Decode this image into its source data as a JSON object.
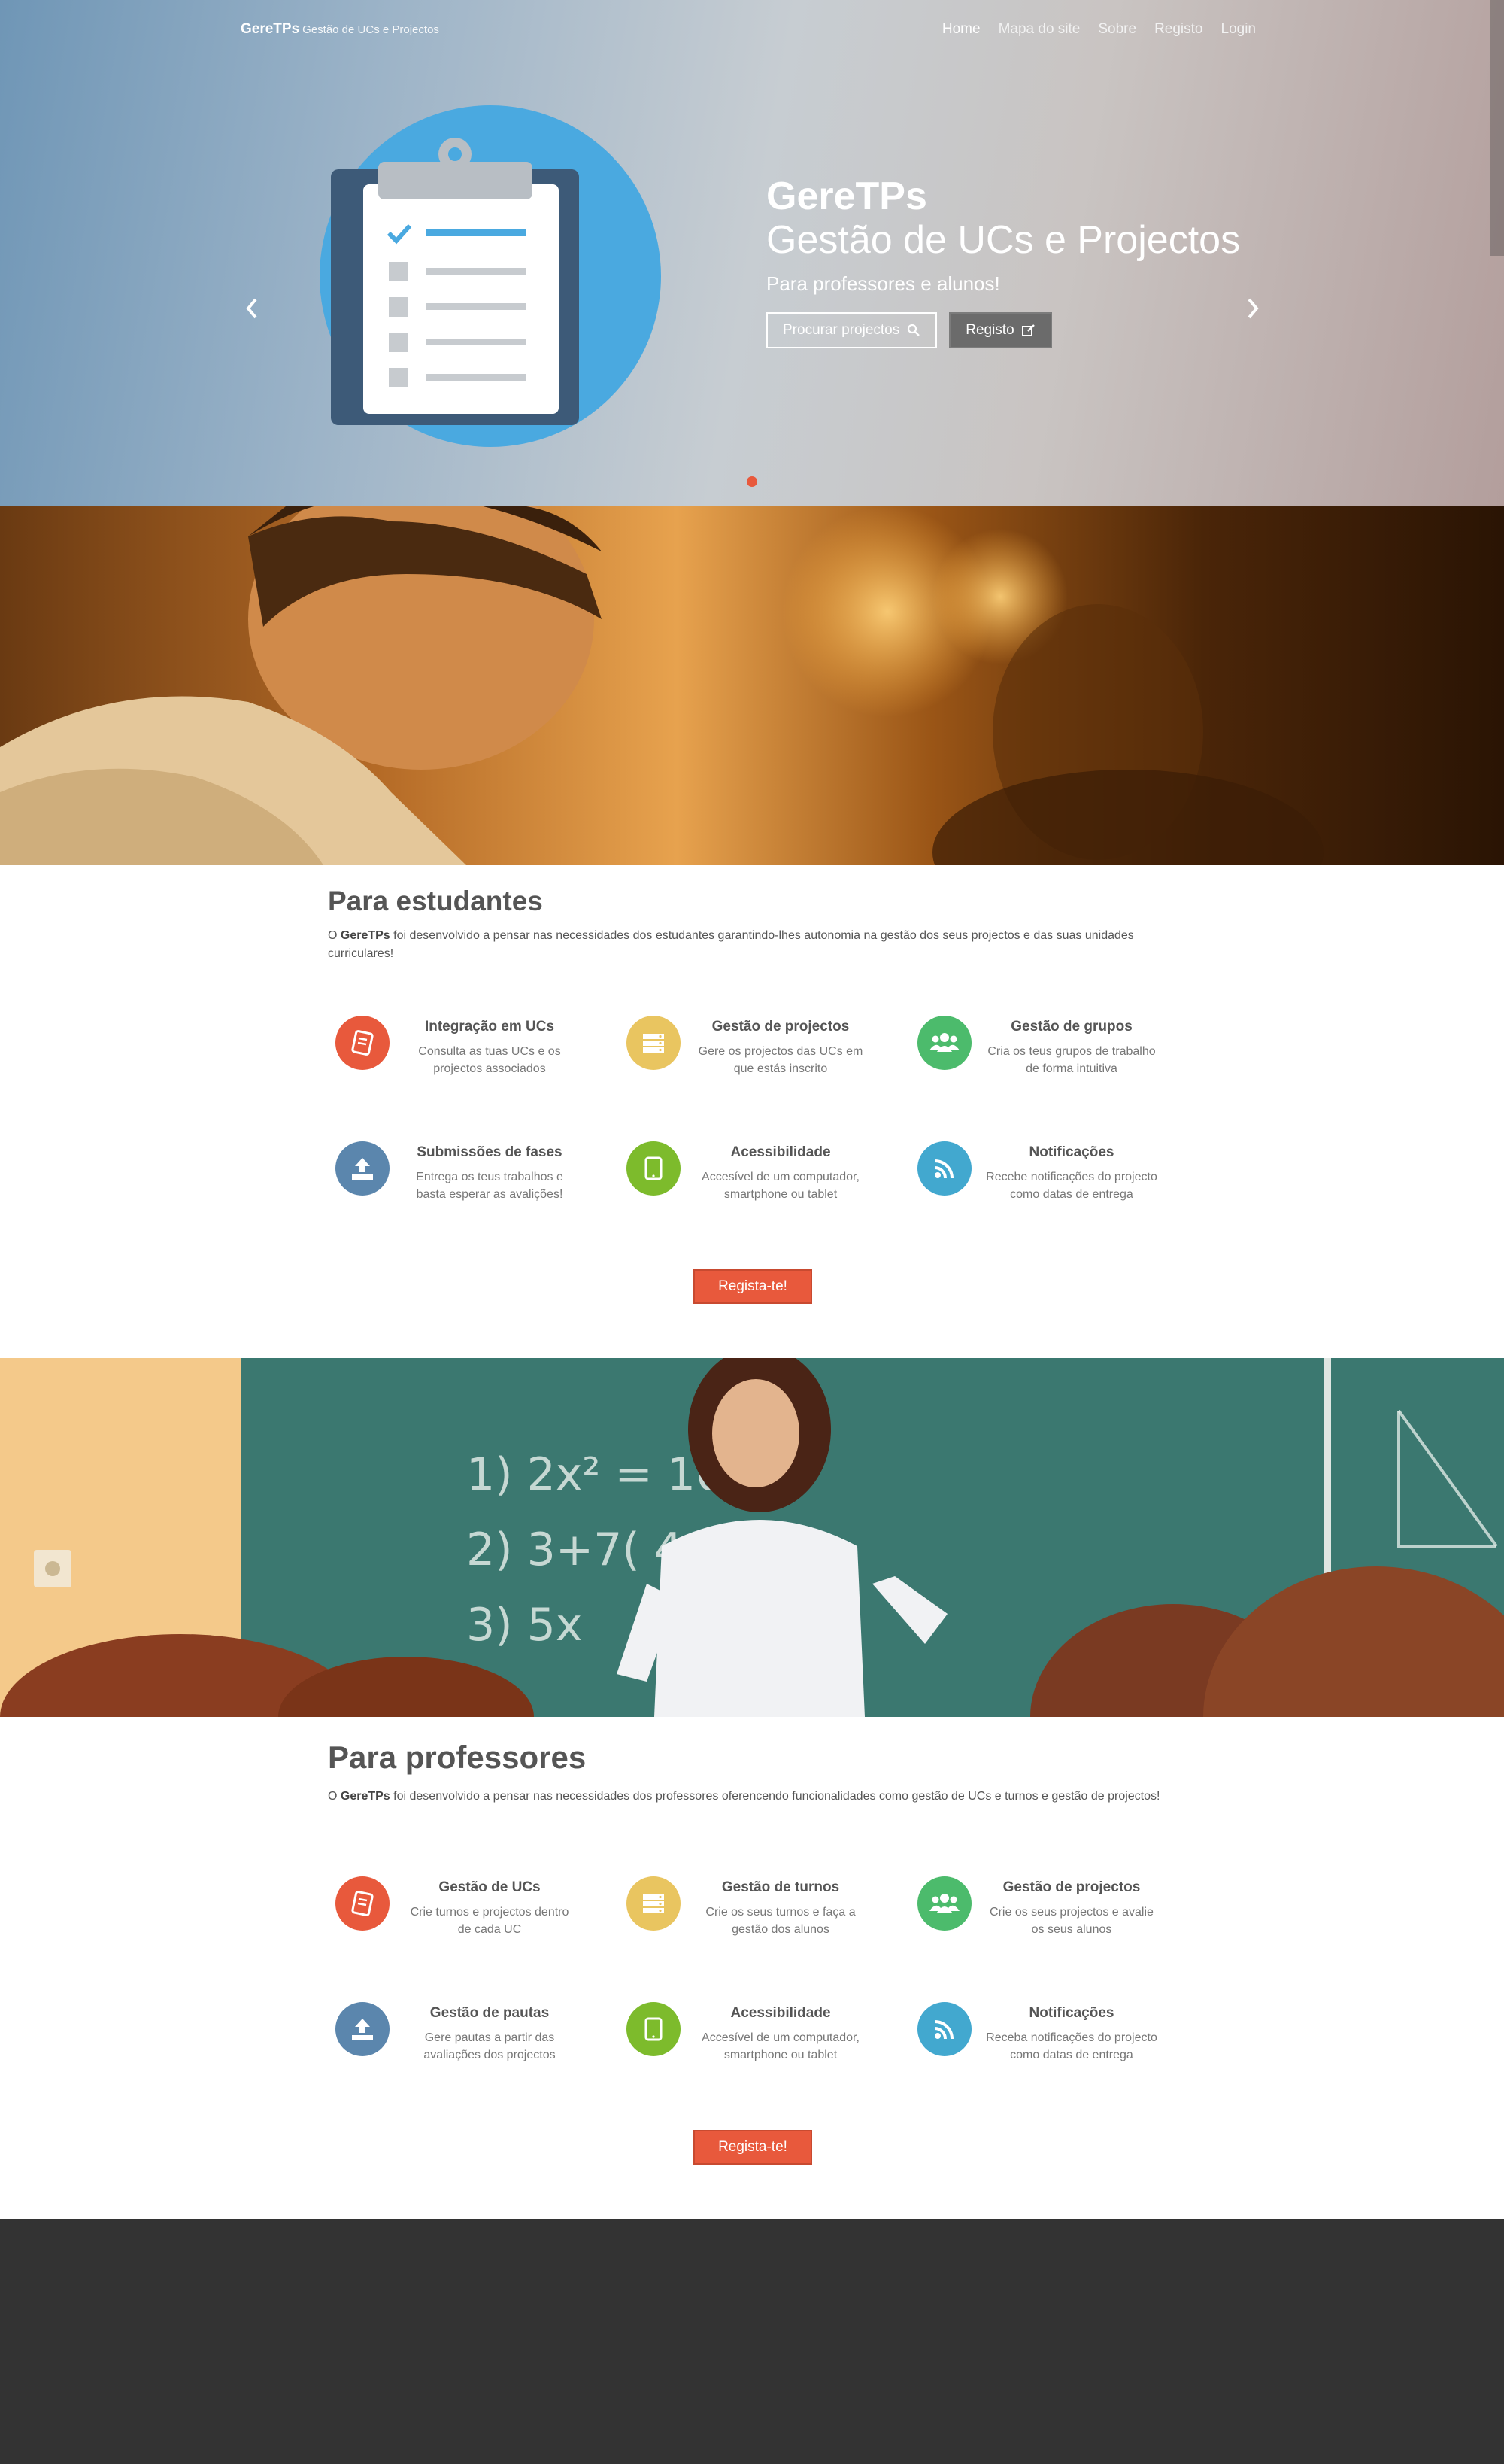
{
  "navbar": {
    "brand_name": "GereTPs",
    "brand_tagline": "Gestão de UCs e Projectos",
    "items": [
      {
        "label": "Home"
      },
      {
        "label": "Mapa do site"
      },
      {
        "label": "Sobre"
      },
      {
        "label": "Registo"
      },
      {
        "label": "Login"
      }
    ]
  },
  "hero": {
    "title": "GereTPs",
    "subtitle": "Gestão de UCs e Projectos",
    "tagline": "Para professores e alunos!",
    "search_button": "Procurar projectos",
    "register_button": "Registo",
    "prev_icon": "chevron-left-icon",
    "next_icon": "chevron-right-icon"
  },
  "students": {
    "title": "Para estudantes",
    "desc_brand": "GereTPs",
    "desc_prefix": "O ",
    "desc_rest": " foi desenvolvido a pensar nas necessidades dos estudantes garantindo-lhes autonomia na gestão dos seus projectos e das suas unidades curriculares!",
    "features": [
      {
        "title": "Integração em UCs",
        "text": "Consulta as tuas UCs e os projectos associados",
        "icon": "book-icon",
        "color": "#e8593c"
      },
      {
        "title": "Gestão de projectos",
        "text": "Gere os projectos das UCs em que estás inscrito",
        "icon": "server-icon",
        "color": "#e9c560"
      },
      {
        "title": "Gestão de grupos",
        "text": "Cria os teus grupos de trabalho de forma intuitiva",
        "icon": "group-icon",
        "color": "#4cbb6c"
      },
      {
        "title": "Submissões de fases",
        "text": "Entrega os teus trabalhos e basta esperar as avalições!",
        "icon": "upload-icon",
        "color": "#5b86ad"
      },
      {
        "title": "Acessibilidade",
        "text": "Accesível de um computador, smartphone ou tablet",
        "icon": "tablet-icon",
        "color": "#7dbb2c"
      },
      {
        "title": "Notificações",
        "text": "Recebe notificações do projecto como datas de entrega",
        "icon": "rss-icon",
        "color": "#42a8cf"
      }
    ],
    "cta": "Regista-te!"
  },
  "teachers": {
    "title": "Para professores",
    "desc_brand": "GereTPs",
    "desc_prefix": "O ",
    "desc_rest": " foi desenvolvido a pensar nas necessidades dos professores oferencendo funcionalidades como gestão de UCs e turnos e gestão de projectos!",
    "features": [
      {
        "title": "Gestão de UCs",
        "text": "Crie turnos e projectos dentro de cada UC",
        "icon": "book-icon",
        "color": "#e8593c"
      },
      {
        "title": "Gestão de turnos",
        "text": "Crie os seus turnos e faça a gestão dos alunos",
        "icon": "server-icon",
        "color": "#e9c560"
      },
      {
        "title": "Gestão de projectos",
        "text": "Crie os seus projectos e avalie os seus alunos",
        "icon": "group-icon",
        "color": "#4cbb6c"
      },
      {
        "title": "Gestão de pautas",
        "text": "Gere pautas a partir das avaliações dos projectos",
        "icon": "upload-icon",
        "color": "#5b86ad"
      },
      {
        "title": "Acessibilidade",
        "text": "Accesível de um computador, smartphone ou tablet",
        "icon": "tablet-icon",
        "color": "#7dbb2c"
      },
      {
        "title": "Notificações",
        "text": "Receba notificações do projecto como datas de entrega",
        "icon": "rss-icon",
        "color": "#42a8cf"
      }
    ],
    "cta": "Regista-te!"
  },
  "chalkboard": {
    "lines": [
      "1) 2x² = 10",
      "2) 3+7(  4=10",
      "3) 5x"
    ]
  }
}
